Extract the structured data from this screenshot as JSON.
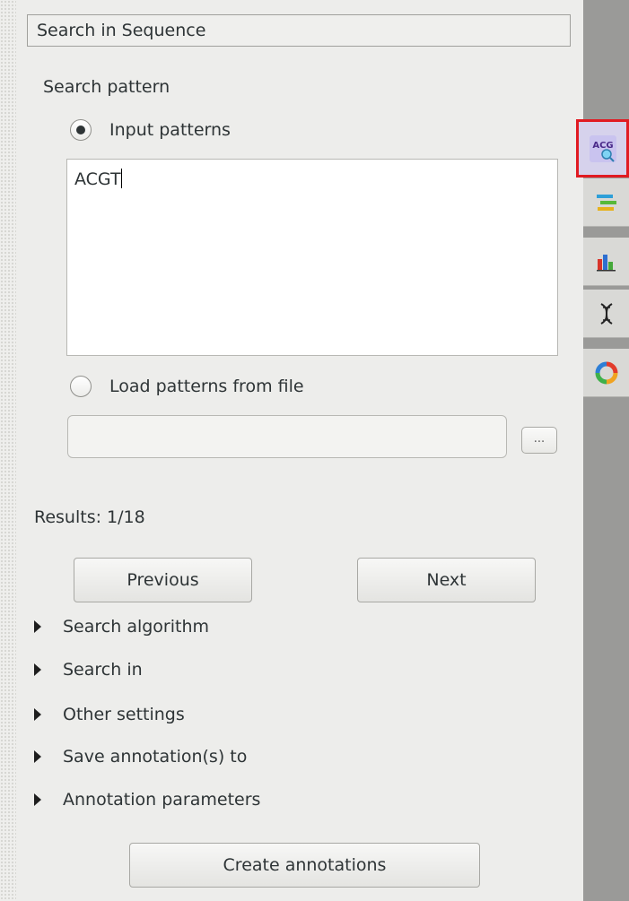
{
  "panel": {
    "title": "Search in Sequence",
    "search_pattern_label": "Search pattern",
    "input_patterns_label": "Input patterns",
    "input_patterns_selected": true,
    "pattern_text": "ACGT",
    "load_from_file_label": "Load patterns from file",
    "load_from_file_selected": false,
    "file_path_value": "",
    "browse_label": "...",
    "results_label": "Results: 1/18",
    "previous_label": "Previous",
    "next_label": "Next",
    "expanders": [
      {
        "label": "Search algorithm"
      },
      {
        "label": "Search in"
      },
      {
        "label": "Other settings"
      },
      {
        "label": "Save annotation(s) to"
      },
      {
        "label": "Annotation parameters"
      }
    ],
    "create_label": "Create annotations"
  },
  "sidebar_tabs": [
    {
      "icon": "acg-search-icon",
      "label": "ACG",
      "active": true
    },
    {
      "icon": "annotations-icon",
      "active": false
    },
    {
      "icon": "statistics-chart-icon",
      "active": false
    },
    {
      "icon": "dna-icon",
      "active": false
    },
    {
      "icon": "circular-view-icon",
      "active": false
    }
  ],
  "colors": {
    "active_tab_border": "#e11b22",
    "panel_background": "#ededeb",
    "sidebar_background": "#9a9a98"
  }
}
